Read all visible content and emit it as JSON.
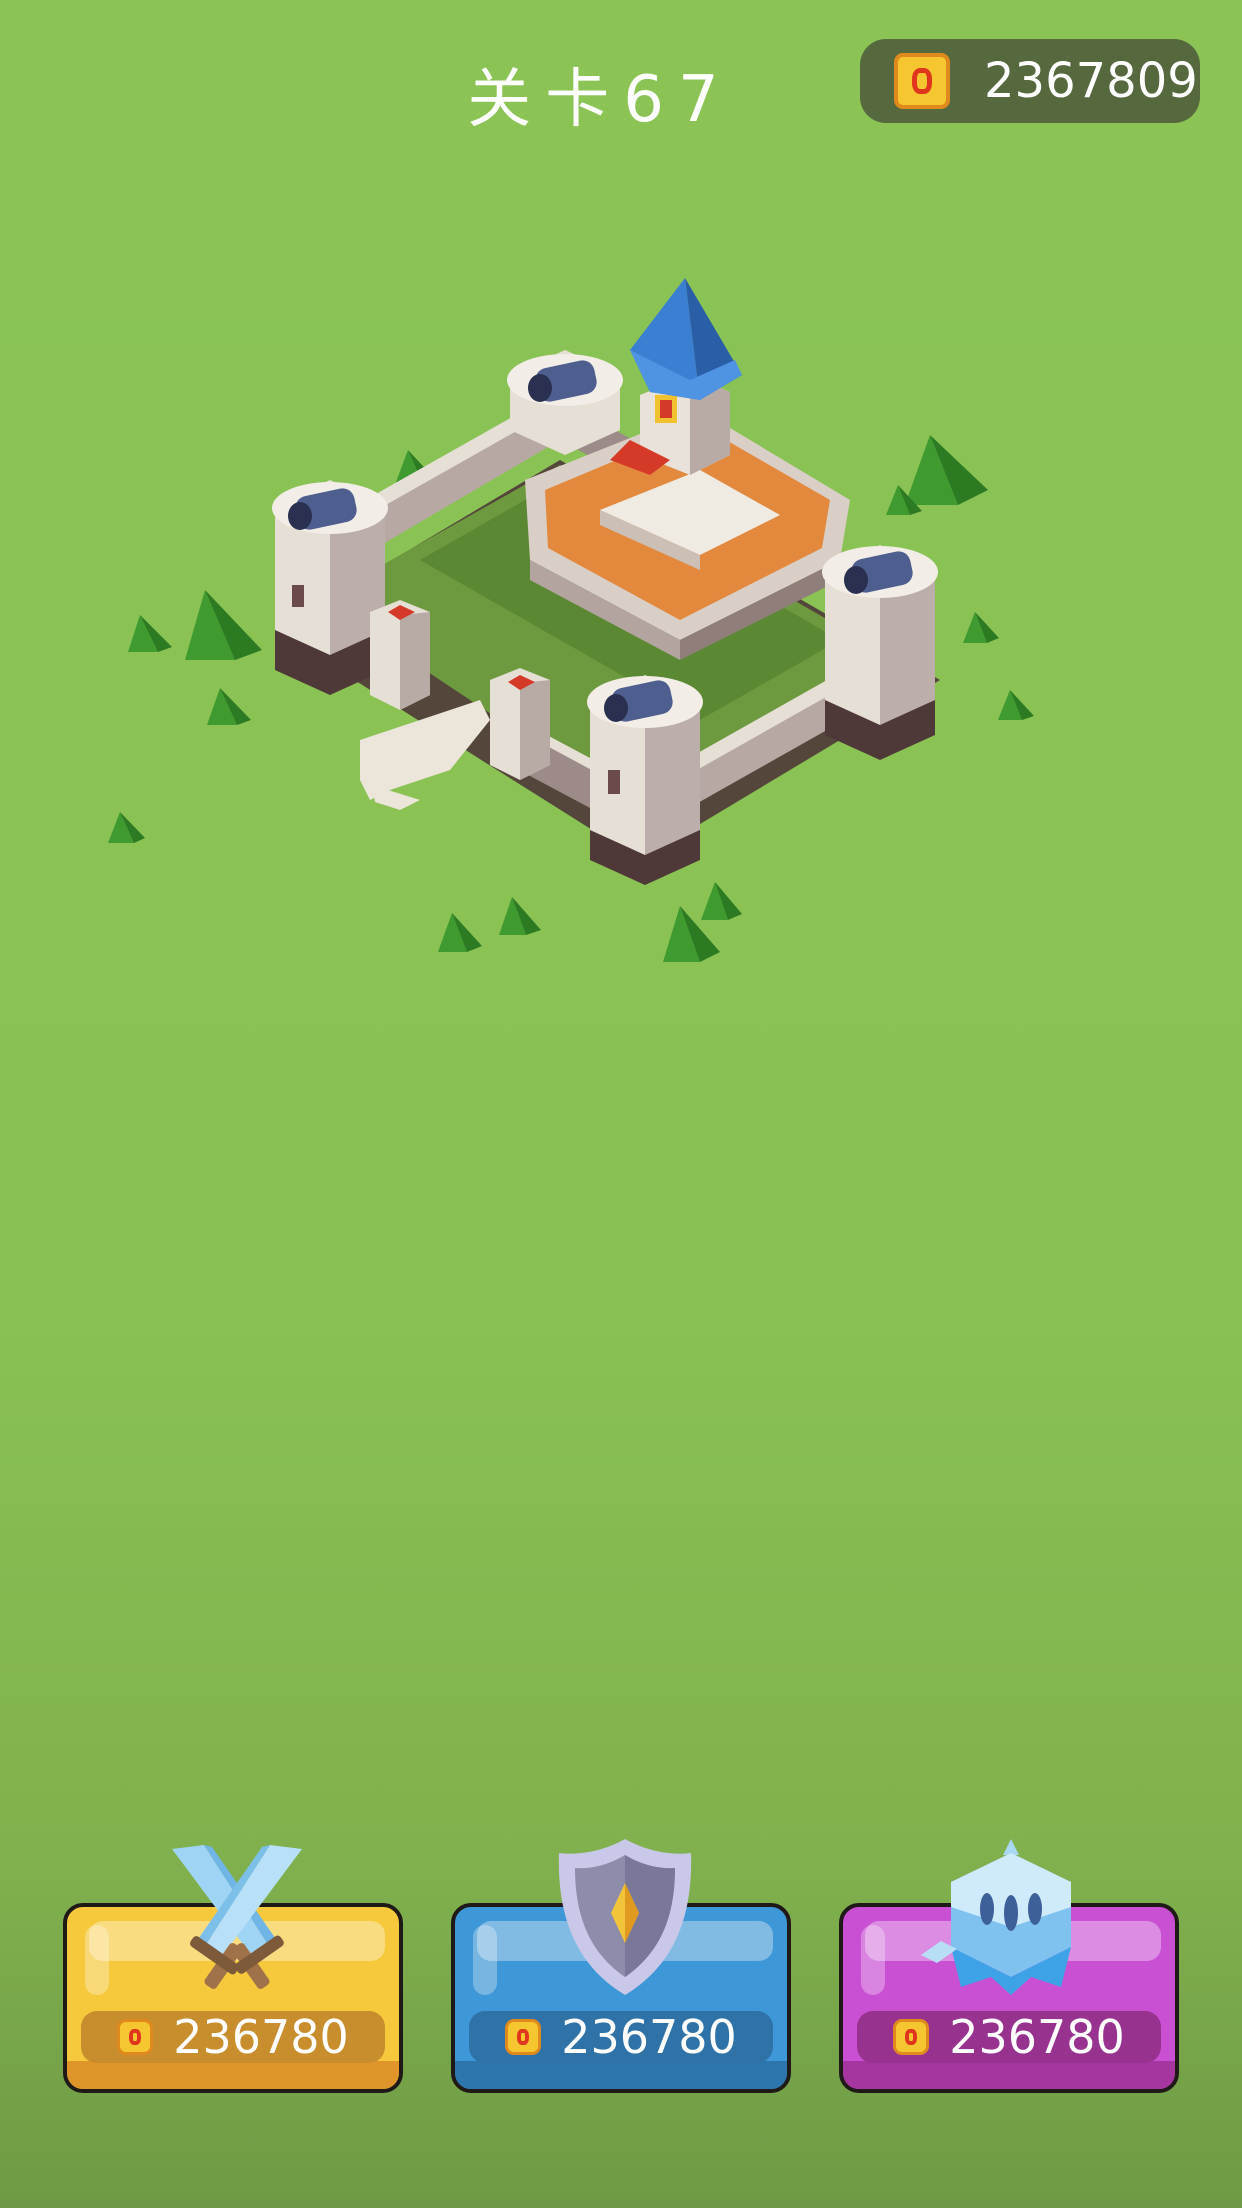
{
  "header": {
    "level_title": "关卡67",
    "coins": "2367809"
  },
  "colors": {
    "background": "#8bc455",
    "coin_gold": "#f5c630",
    "attack_button": "#f6c93d",
    "defense_button": "#3e97d6",
    "troops_button": "#c94fd3"
  },
  "scene": {
    "object": "castle-icon"
  },
  "upgrades": [
    {
      "icon": "crossed-swords-icon",
      "price": "236780"
    },
    {
      "icon": "shield-icon",
      "price": "236780"
    },
    {
      "icon": "knight-helmet-icon",
      "price": "236780"
    }
  ]
}
